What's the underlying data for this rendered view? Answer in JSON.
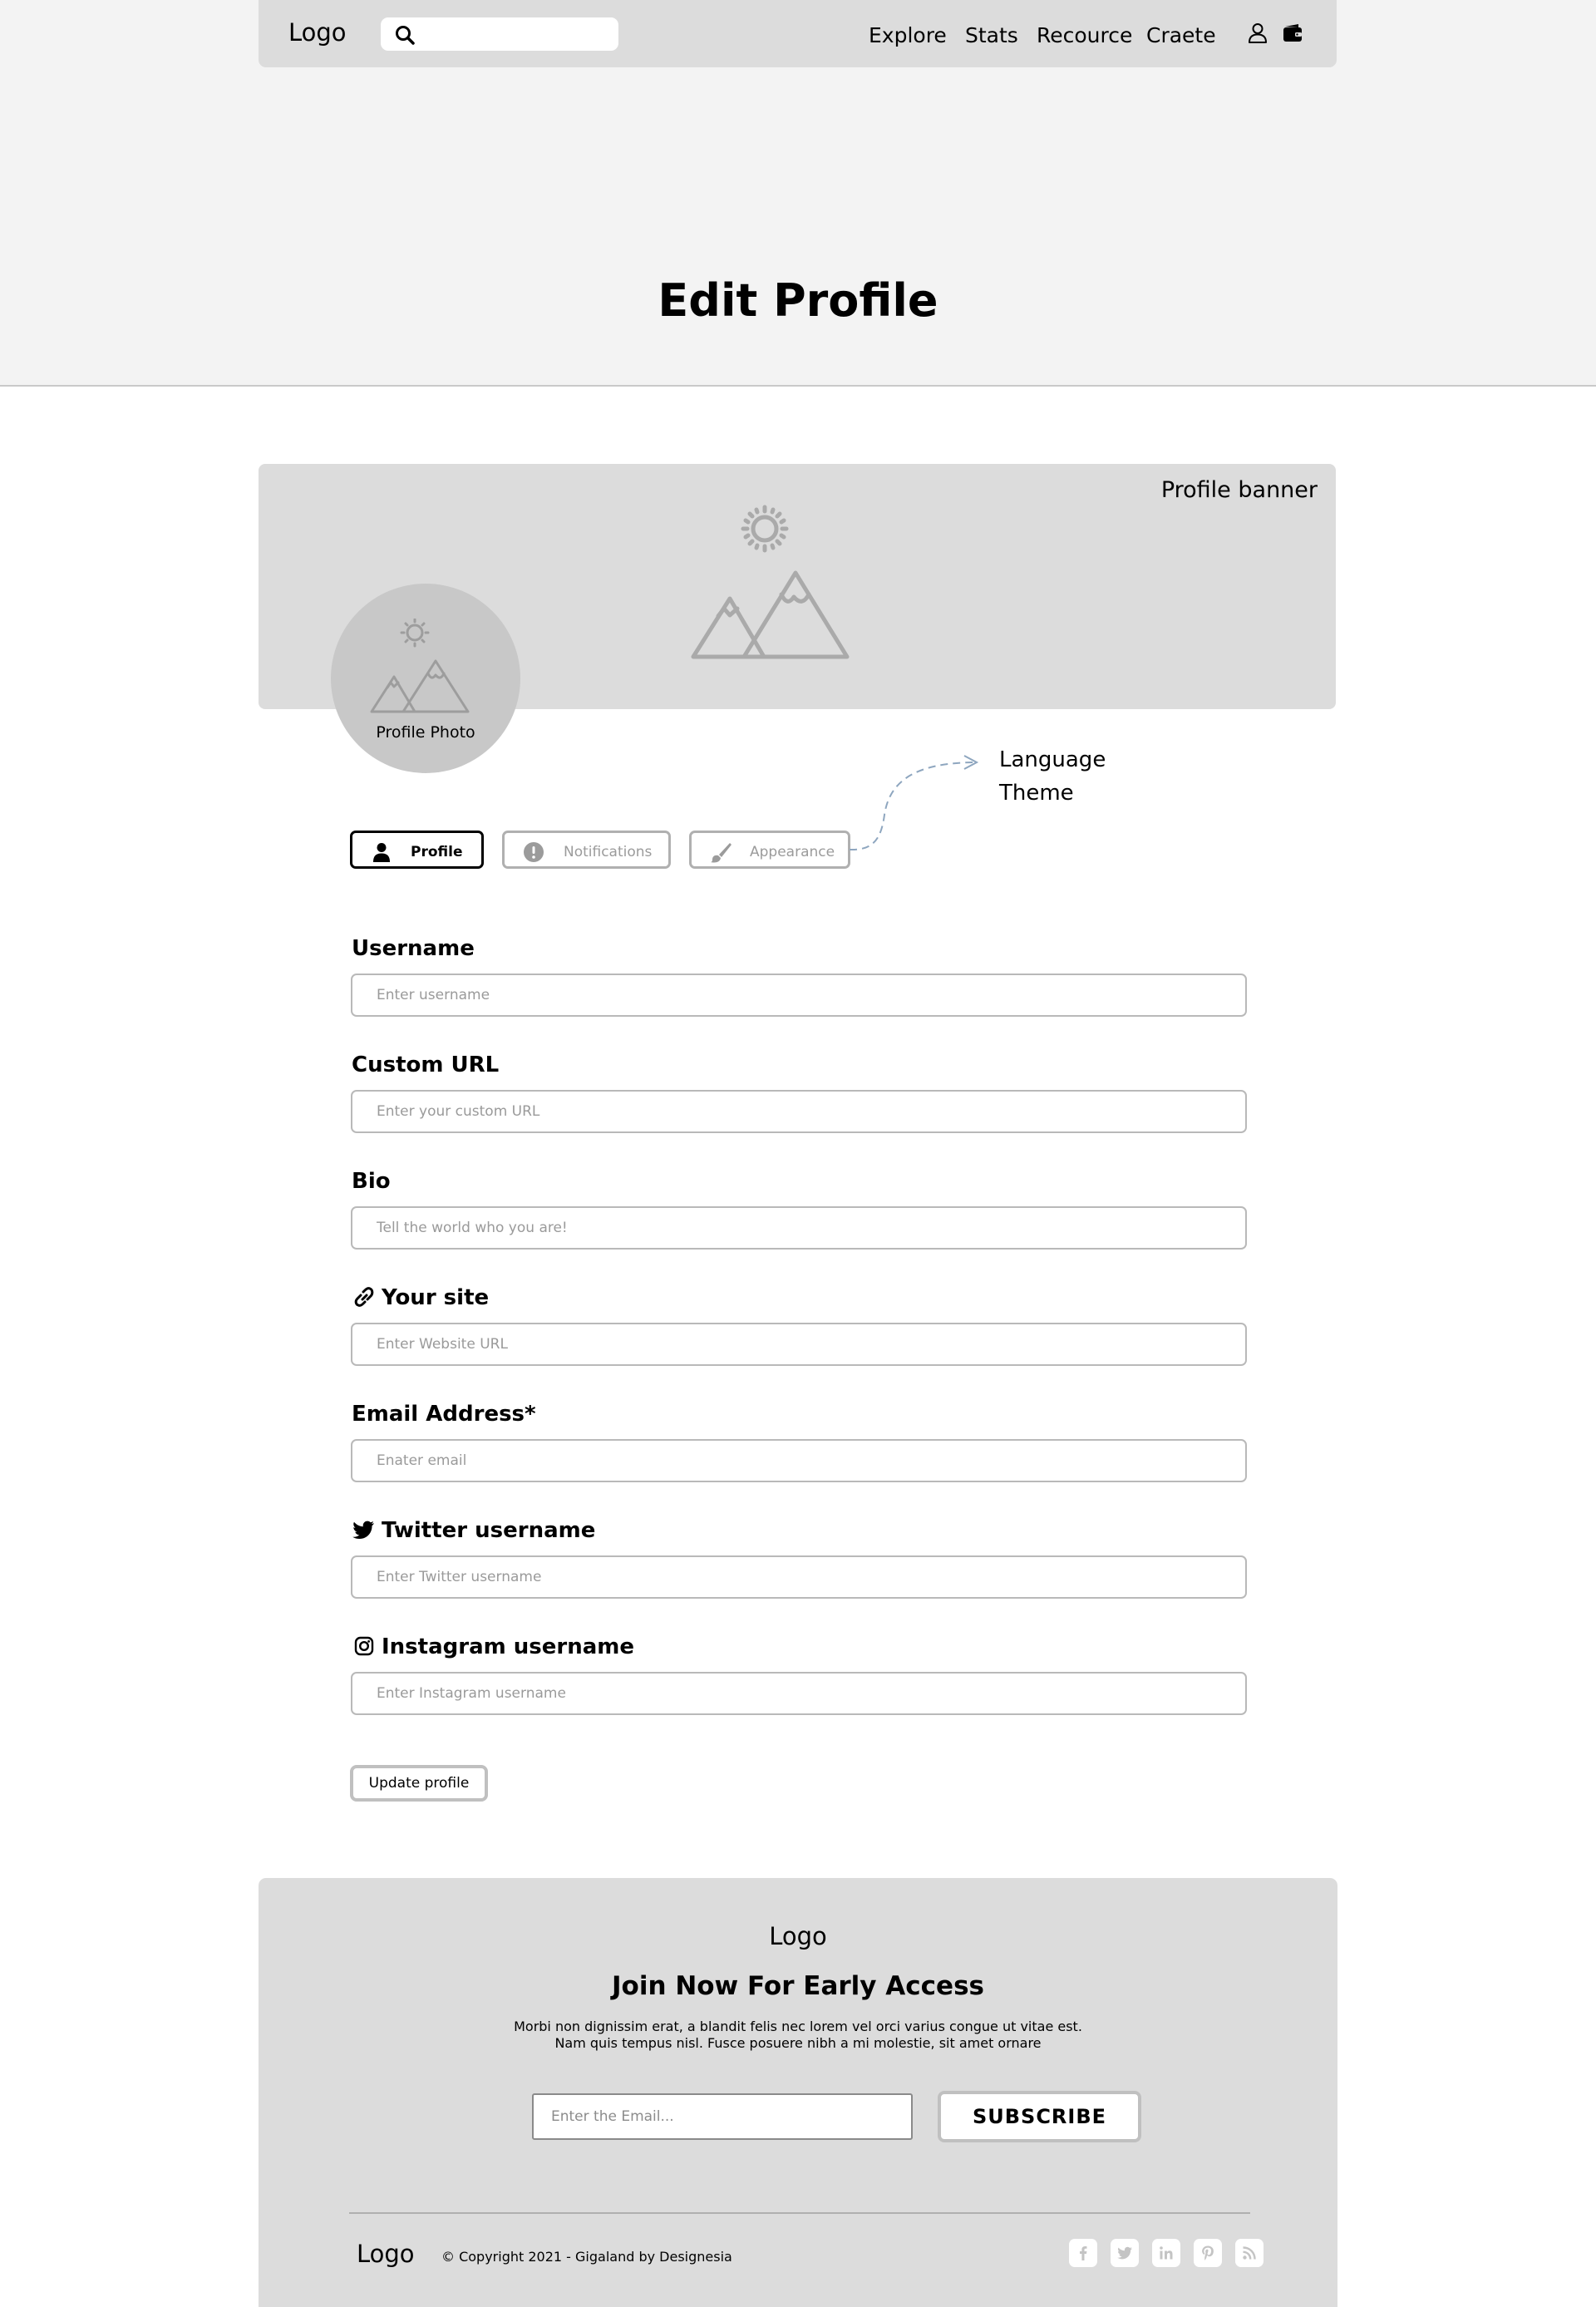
{
  "header": {
    "logo": "Logo",
    "search_placeholder": "",
    "nav": {
      "explore": "Explore",
      "stats": "Stats",
      "resource": "Recource",
      "create": "Craete"
    },
    "icons": [
      "search-icon",
      "user-icon",
      "wallet-icon"
    ]
  },
  "page": {
    "title": "Edit Profile"
  },
  "banner": {
    "label": "Profile banner",
    "avatar_label": "Profile Photo"
  },
  "tabs": {
    "profile": "Profile",
    "notifications": "Notifications",
    "appearance": "Appearance"
  },
  "appearance_menu": {
    "language": "Language",
    "theme": "Theme"
  },
  "form": {
    "username": {
      "label": "Username",
      "placeholder": "Enter username"
    },
    "custom_url": {
      "label": "Custom URL",
      "placeholder": "Enter your custom URL"
    },
    "bio": {
      "label": "Bio",
      "placeholder": "Tell the world who you are!"
    },
    "site": {
      "label": "Your site",
      "placeholder": "Enter Website URL"
    },
    "email": {
      "label": "Email Address*",
      "placeholder": "Enater email"
    },
    "twitter": {
      "label": "Twitter username",
      "placeholder": "Enter Twitter username"
    },
    "instagram": {
      "label": "Instagram username",
      "placeholder": "Enter Instagram username"
    },
    "submit": "Update profile"
  },
  "footer": {
    "logo": "Logo",
    "heading": "Join Now For Early Access",
    "text": "Morbi non dignissim erat, a blandit felis nec lorem vel orci varius congue ut vitae est. Nam quis tempus nisl. Fusce posuere nibh a mi molestie, sit amet ornare",
    "email_placeholder": "Enter the Email...",
    "subscribe": "SUBSCRIBE",
    "bottom_logo": "Logo",
    "copyright": "© Copyright 2021 - Gigaland by Designesia",
    "social": [
      "facebook-icon",
      "twitter-icon",
      "linkedin-icon",
      "pinterest-icon",
      "rss-icon"
    ]
  },
  "colors": {
    "hero_bg": "#f3f3f3",
    "panel_bg": "#dcdcdc",
    "avatar_bg": "#c8c8c8",
    "illustration": "#aaaaaa",
    "border": "#b9b9b9",
    "inactive_text": "#9b9b9b"
  }
}
